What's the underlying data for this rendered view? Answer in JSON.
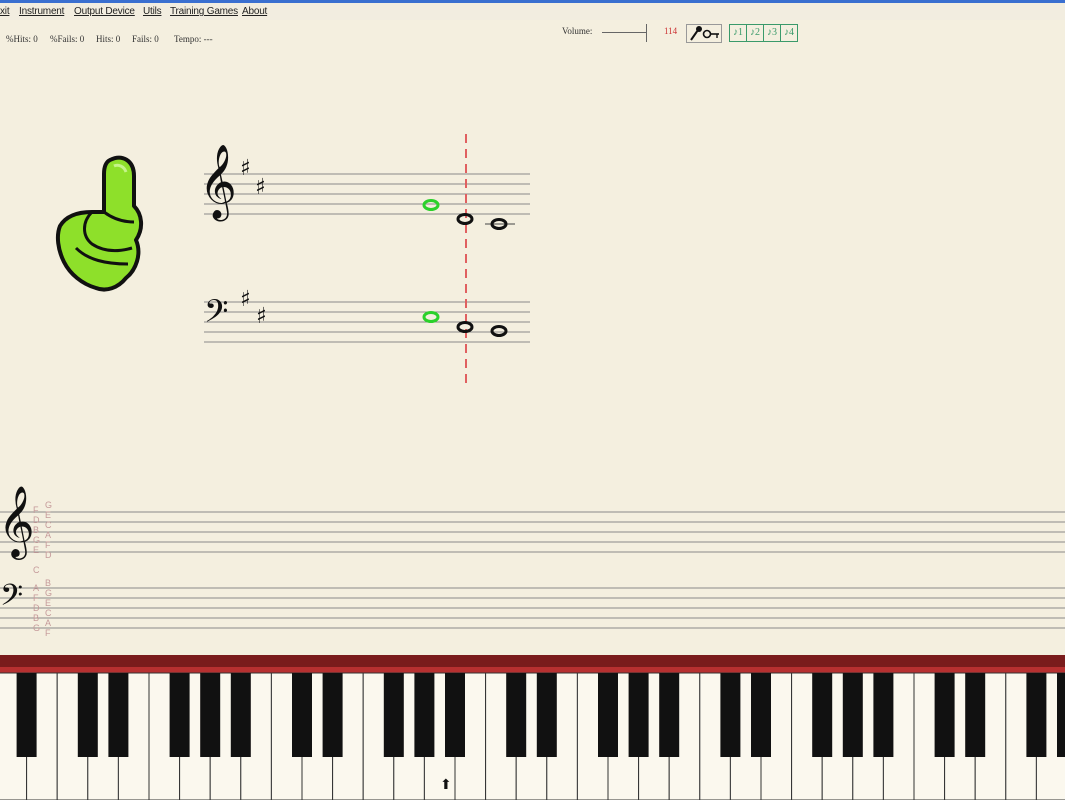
{
  "menu": [
    "xit",
    "Instrument",
    "Output Device",
    "Utils",
    "Training Games",
    "About"
  ],
  "stats": {
    "pct_hits": "%Hits: 0",
    "pct_fails": "%Fails: 0",
    "hits": "Hits: 0",
    "fails": "Fails: 0",
    "tempo": "Tempo: ---"
  },
  "toolbar": {
    "volume_label": "Volume:",
    "volume_value": "114",
    "tool_buttons": [
      "mic-key-icon"
    ],
    "toggle_labels": [
      "♪1",
      "♪2",
      "♪3",
      "♪4"
    ]
  },
  "colors": {
    "background": "#f4efdf",
    "correct_note": "#2bd12b",
    "cursor_line": "#e06060",
    "piano_strip": "#8b1e1e"
  },
  "icons": {
    "feedback": "thumbs-up-icon",
    "piano_marker": "up-arrow-icon"
  },
  "note_labels": {
    "treble_left": [
      "F",
      "D",
      "B",
      "G",
      "E"
    ],
    "treble_right": [
      "G",
      "E",
      "C",
      "A",
      "F",
      "D"
    ],
    "middle": "C",
    "bass_left": [
      "A",
      "F",
      "D",
      "B",
      "G"
    ],
    "bass_right": [
      "B",
      "G",
      "E",
      "C",
      "A",
      "F"
    ]
  }
}
